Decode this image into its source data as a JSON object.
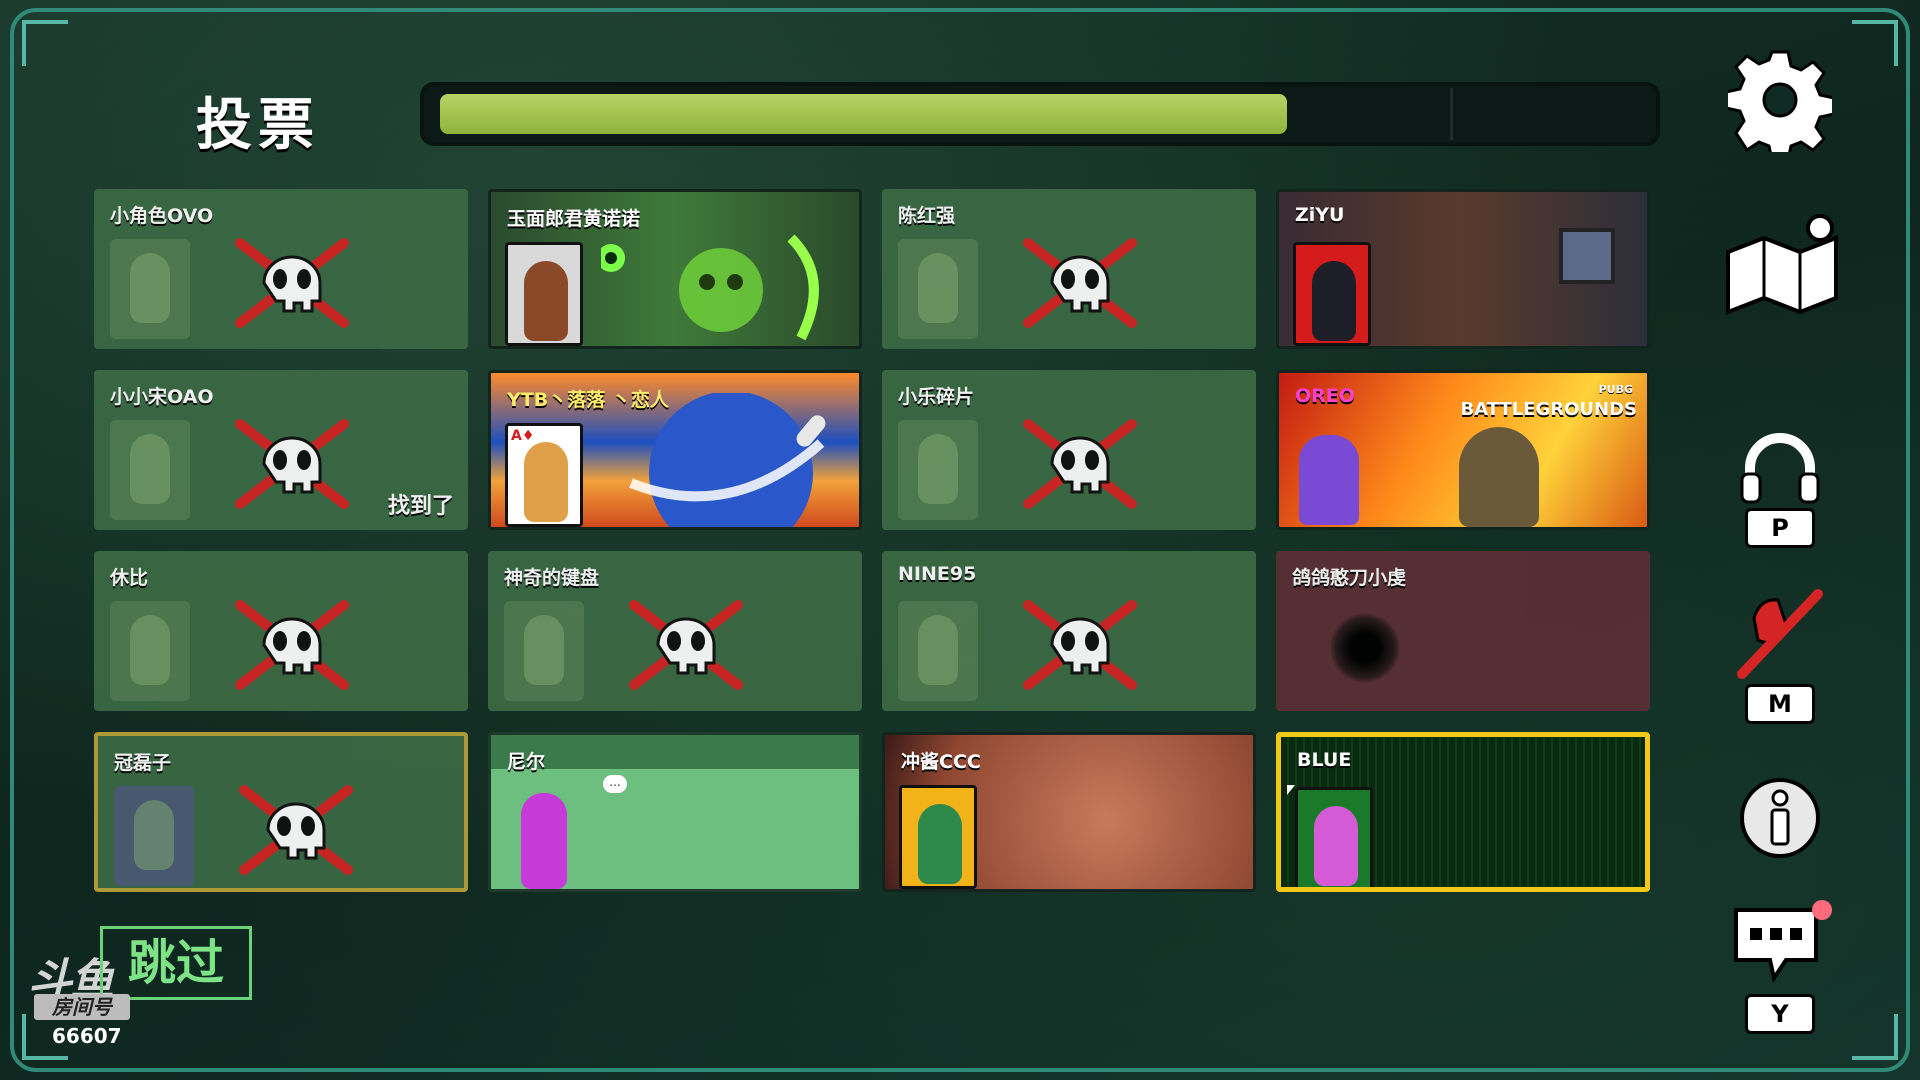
{
  "header": {
    "title": "投票",
    "timer_progress": 0.83
  },
  "players": [
    {
      "name": "小角色OVO",
      "state": "dead"
    },
    {
      "name": "玉面郎君黄诺诺",
      "state": "alive"
    },
    {
      "name": "陈红强",
      "state": "dead"
    },
    {
      "name": "ZiYU",
      "state": "alive"
    },
    {
      "name": "小小宋OAO",
      "state": "dead",
      "tag": "找到了"
    },
    {
      "name": "YTB丶落落 丶恋人",
      "state": "alive"
    },
    {
      "name": "小乐碎片",
      "state": "dead"
    },
    {
      "name": "OREO",
      "state": "alive",
      "banner_text": "BATTLEGROUNDS",
      "banner_sub": "PUBG"
    },
    {
      "name": "休比",
      "state": "dead"
    },
    {
      "name": "神奇的键盘",
      "state": "dead"
    },
    {
      "name": "NINE95",
      "state": "dead"
    },
    {
      "name": "鸽鸽憨刀小虔",
      "state": "disconnected"
    },
    {
      "name": "冠磊子",
      "state": "dead"
    },
    {
      "name": "尼尔",
      "state": "alive",
      "bubble": "..."
    },
    {
      "name": "冲酱CCC",
      "state": "alive"
    },
    {
      "name": "BLUE",
      "state": "alive",
      "selected": true
    }
  ],
  "sidebar": {
    "settings_icon": "gear-icon",
    "map_icon": "map-icon",
    "voice_key": "P",
    "mute_key": "M",
    "chat_key": "Y"
  },
  "footer": {
    "skip_label": "跳过",
    "logo_text": "斗鱼",
    "room_label": "房间号",
    "room_number": "66607"
  },
  "colors": {
    "frame": "#2f8b78",
    "timer_fill": "#9dc24a",
    "dead_card": "#3c6a44",
    "skip_green": "#7ee386",
    "selected_border": "#f2c81a"
  }
}
